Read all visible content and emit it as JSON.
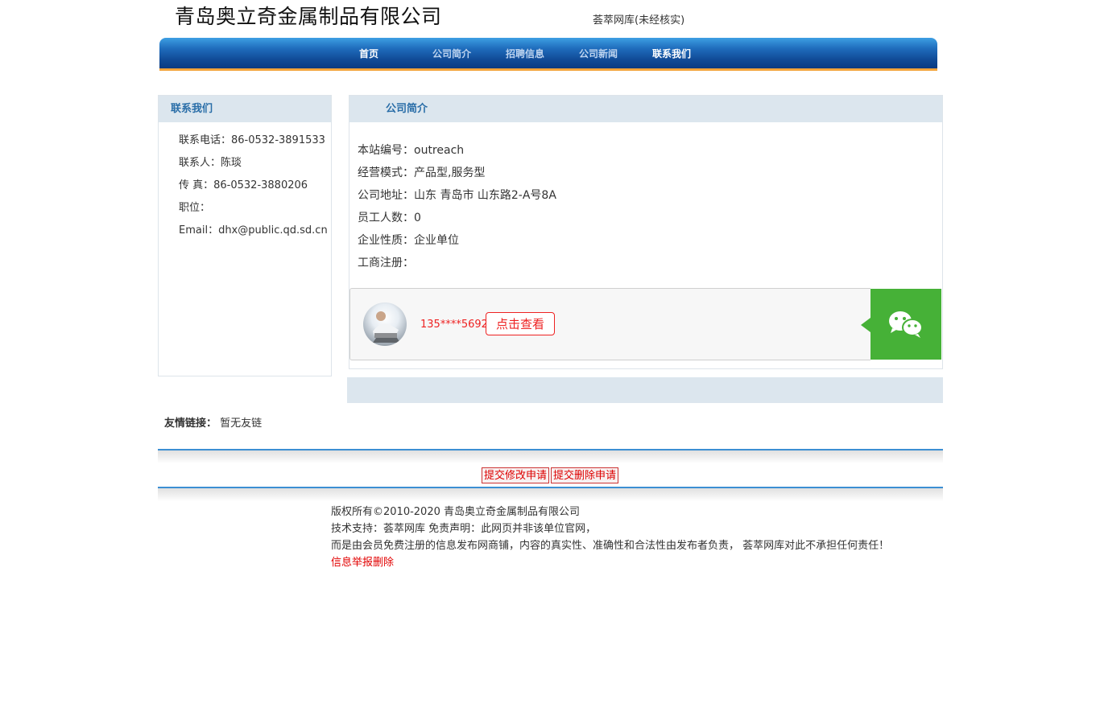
{
  "header": {
    "company_name": "青岛奥立奇金属制品有限公司",
    "site_note": "荟萃网库(未经核实)"
  },
  "nav": [
    {
      "label": "首页"
    },
    {
      "label": "公司简介"
    },
    {
      "label": "招聘信息"
    },
    {
      "label": "公司新闻"
    },
    {
      "label": "联系我们"
    }
  ],
  "sidebar": {
    "title": "联系我们",
    "items": [
      "联系电话：86-0532-3891533",
      "联系人：陈琰",
      "传 真：86-0532-3880206",
      "职位：",
      "Email：dhx@public.qd.sd.cn"
    ]
  },
  "main": {
    "title": "公司简介",
    "items": [
      "本站编号：outreach",
      "经营模式：产品型,服务型",
      "公司地址：山东 青岛市 山东路2-A号8A",
      "员工人数：0",
      "企业性质：企业单位",
      "工商注册："
    ]
  },
  "phone_card": {
    "phone": "135****5692",
    "button_label": "点击查看",
    "avatar_icon": "person-avatar-icon",
    "wechat_icon": "wechat-icon",
    "wechat_color": "#46b137"
  },
  "friend_links": {
    "label": "友情链接：",
    "value": "暂无友链"
  },
  "requests": {
    "modify": "提交修改申请",
    "delete": "提交删除申请"
  },
  "footer": {
    "copyright": "版权所有©2010-2020 青岛奥立奇金属制品有限公司",
    "support": "技术支持：荟萃网库 免责声明：此网页并非该单位官网，",
    "disclaimer": "而是由会员免费注册的信息发布网商铺，内容的真实性、准确性和合法性由发布者负责， 荟萃网库对此不承担任何责任！",
    "report": "信息举报删除"
  }
}
